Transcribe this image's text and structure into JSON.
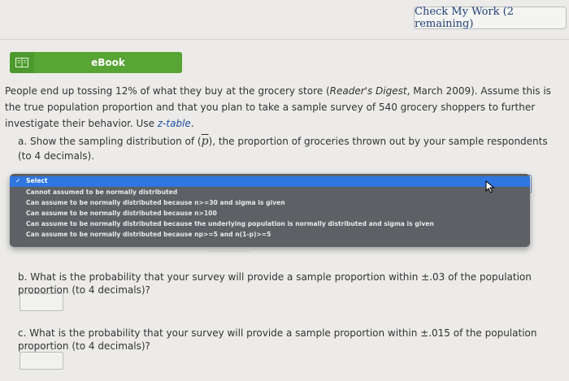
{
  "header": {
    "check_label": "Check My Work (2 remaining)"
  },
  "ebook": {
    "label": "eBook",
    "icon": "book-icon"
  },
  "intro": {
    "part1": "People end up tossing 12% of what they buy at the grocery store (",
    "source": "Reader's Digest",
    "part2": ", March 2009). Assume this is the true population proportion and that you plan to take a sample survey of 540 grocery shoppers to further investigate their behavior. Use ",
    "link": "z-table",
    "part3": "."
  },
  "question_a": {
    "prefix": "a. Show the sampling distribution of (",
    "symbol": "p",
    "suffix": "), the proportion of groceries thrown out by your sample respondents (to 4 decimals)."
  },
  "dropdown": {
    "options": [
      "Select",
      "Cannot assumed to be normally distributed",
      "Can assume to be normally distributed because n>=30 and sigma is given",
      "Can assume to be normally distributed because n>100",
      "Can assume to be normally distributed because the underlying population is normally distributed and sigma is given",
      "Can assume to be normally distributed because np>=5 and n(1-p)>=5"
    ],
    "selected_index": 0
  },
  "question_b": {
    "text": "b. What is the probability that your survey will provide a sample proportion within ±.03 of the population proportion (to 4 decimals)?",
    "value": ""
  },
  "question_c": {
    "text": "c. What is the probability that your survey will provide a sample proportion within ±.015 of the population proportion (to 4 decimals)?",
    "value": ""
  }
}
